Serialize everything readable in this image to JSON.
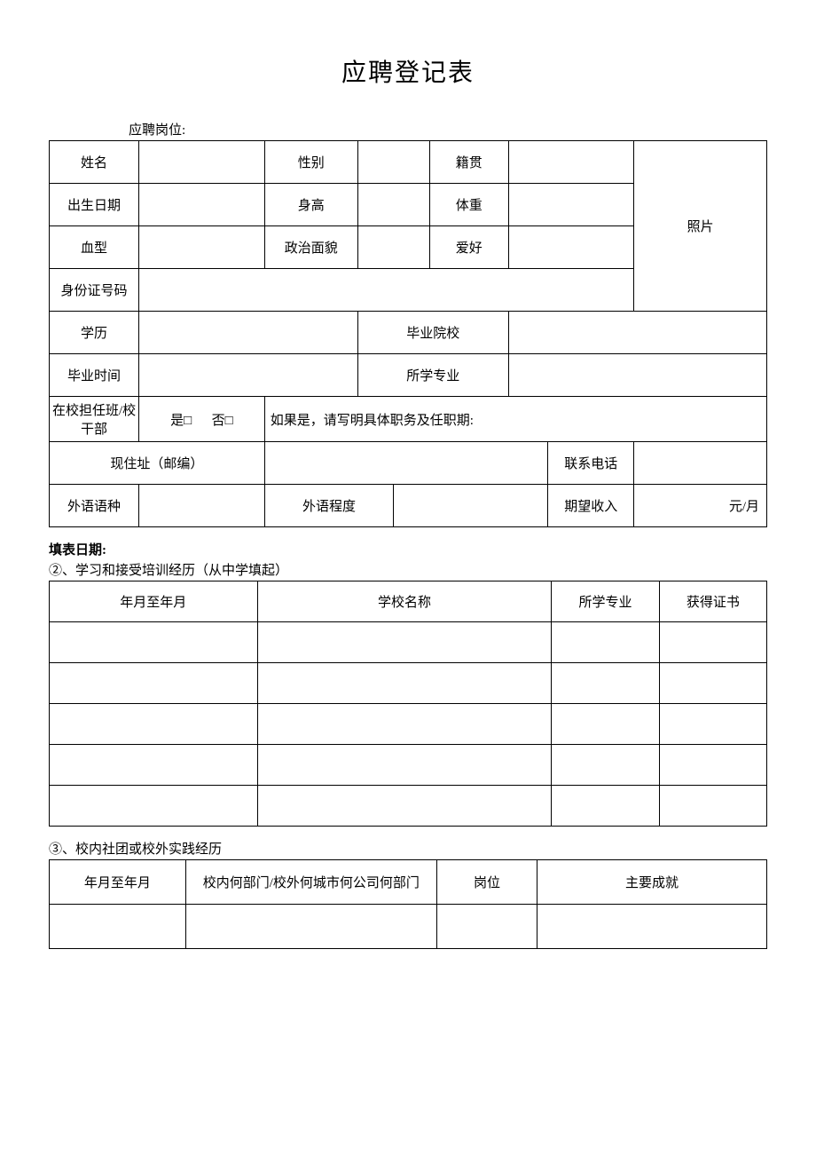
{
  "title": "应聘登记表",
  "position_label": "应聘岗位:",
  "main": {
    "name_label": "姓名",
    "gender_label": "性别",
    "native_place_label": "籍贯",
    "photo_label": "照片",
    "birth_label": "出生日期",
    "height_label": "身高",
    "weight_label": "体重",
    "blood_label": "血型",
    "politics_label": "政治面貌",
    "hobby_label": "爱好",
    "id_number_label": "身份证号码",
    "education_label": "学历",
    "grad_school_label": "毕业院校",
    "grad_time_label": "毕业时间",
    "major_label": "所学专业",
    "school_cadre_label": "在校担任班/校干部",
    "yes_option": "是□",
    "no_option": "否□",
    "cadre_detail_label": "如果是，请写明具体职务及任职期:",
    "address_label": "现住址（邮编）",
    "phone_label": "联系电话",
    "foreign_lang_label": "外语语种",
    "foreign_level_label": "外语程度",
    "expected_salary_label": "期望收入",
    "salary_unit": "元/月",
    "name_value": "",
    "gender_value": "",
    "native_place_value": "",
    "birth_value": "",
    "height_value": "",
    "weight_value": "",
    "blood_value": "",
    "politics_value": "",
    "hobby_value": "",
    "id_number_value": "",
    "education_value": "",
    "grad_school_value": "",
    "grad_time_value": "",
    "major_value": "",
    "address_value": "",
    "phone_value": "",
    "foreign_lang_value": "",
    "foreign_level_value": "",
    "expected_salary_value": ""
  },
  "fill_date_label": "填表日期:",
  "section2_label": "②、学习和接受培训经历（从中学填起）",
  "edu_headers": {
    "period": "年月至年月",
    "school": "学校名称",
    "major": "所学专业",
    "cert": "获得证书"
  },
  "edu_rows": [
    {
      "period": "",
      "school": "",
      "major": "",
      "cert": ""
    },
    {
      "period": "",
      "school": "",
      "major": "",
      "cert": ""
    },
    {
      "period": "",
      "school": "",
      "major": "",
      "cert": ""
    },
    {
      "period": "",
      "school": "",
      "major": "",
      "cert": ""
    },
    {
      "period": "",
      "school": "",
      "major": "",
      "cert": ""
    }
  ],
  "section3_label": "③、校内社团或校外实践经历",
  "exp_headers": {
    "period": "年月至年月",
    "dept": "校内何部门/校外何城市何公司何部门",
    "post": "岗位",
    "achievement": "主要成就"
  },
  "exp_rows": [
    {
      "period": "",
      "dept": "",
      "post": "",
      "achievement": ""
    }
  ]
}
